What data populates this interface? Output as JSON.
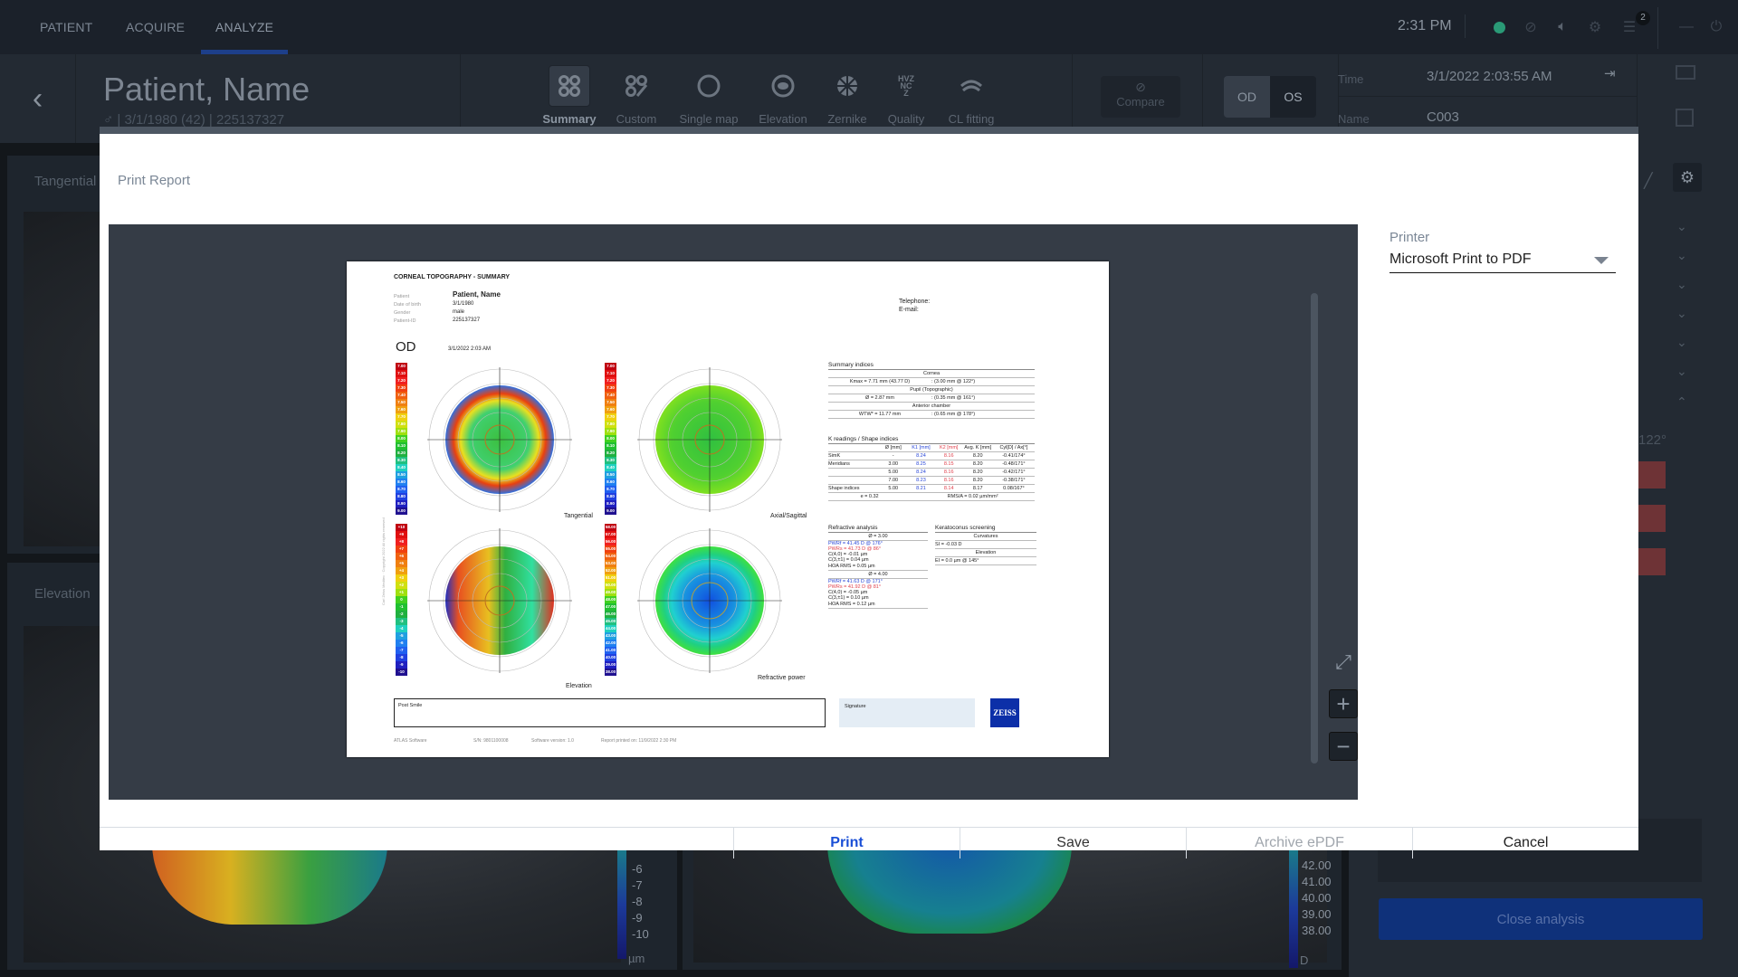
{
  "topbar": {
    "tabs": [
      {
        "label": "PATIENT",
        "active": false
      },
      {
        "label": "ACQUIRE",
        "active": false
      },
      {
        "label": "ANALYZE",
        "active": true
      }
    ],
    "clock": "2:31 PM",
    "status_color": "#2a9a76",
    "notification_count": "2",
    "icons": [
      "status-dot-icon",
      "visibility-off-icon",
      "volume-icon",
      "settings-icon",
      "task-list-icon",
      "minimize-icon",
      "power-icon"
    ]
  },
  "header": {
    "patient_name": "Patient, Name",
    "gender_symbol": "♂",
    "birth_info": "3/1/1980 (42)",
    "patient_id": "225137327",
    "view_tools": [
      {
        "label": "Summary",
        "icon": "summary-grid-icon",
        "active": true
      },
      {
        "label": "Custom",
        "icon": "custom-grid-icon",
        "active": false
      },
      {
        "label": "Single map",
        "icon": "single-map-icon",
        "active": false
      },
      {
        "label": "Elevation",
        "icon": "elevation-icon",
        "active": false
      },
      {
        "label": "Zernike",
        "icon": "zernike-icon",
        "active": false
      },
      {
        "label": "Quality",
        "icon": "quality-icon",
        "active": false
      },
      {
        "label": "CL fitting",
        "icon": "cl-fitting-icon",
        "active": false
      }
    ],
    "compare_label": "Compare",
    "eye_od": "OD",
    "eye_os": "OS",
    "selected_eye": "OD",
    "time_label": "Time",
    "time_value": "3/1/2022 2:03:55 AM",
    "name_label": "Name",
    "name_value": "C003"
  },
  "background": {
    "panel_tangential": "Tangential",
    "panel_elevation": "Elevation",
    "elevation_scale": [
      "-6",
      "-7",
      "-8",
      "-9",
      "-10"
    ],
    "elevation_unit": "µm",
    "power_scale": [
      "42.00",
      "41.00",
      "40.00",
      "39.00",
      "38.00"
    ],
    "power_unit": "D",
    "axis_angle_text": "122°",
    "close_analysis": "Close analysis"
  },
  "dialog": {
    "title": "Print Report",
    "printer_label": "Printer",
    "printer_value": "Microsoft Print to PDF",
    "buttons": {
      "print": "Print",
      "save": "Save",
      "archive": "Archive ePDF",
      "cancel": "Cancel"
    },
    "accent_color": "#1a4fd6"
  },
  "report": {
    "title": "CORNEAL TOPOGRAPHY - SUMMARY",
    "fields": [
      {
        "label": "Patient",
        "value": "Patient, Name"
      },
      {
        "label": "Date of birth",
        "value": "3/1/1980"
      },
      {
        "label": "Gender",
        "value": "male"
      },
      {
        "label": "Patient-ID",
        "value": "225137327"
      }
    ],
    "telephone": "Telephone:",
    "email": "E-mail:",
    "eye": "OD",
    "exam_date": "3/1/2022 2:03 AM",
    "maps": [
      {
        "label": "Tangential"
      },
      {
        "label": "Axial/Sagittal"
      },
      {
        "label": "Elevation"
      },
      {
        "label": "Refractive power"
      }
    ],
    "scale_radius": [
      "7.00",
      "7.10",
      "7.20",
      "7.30",
      "7.40",
      "7.50",
      "7.60",
      "7.70",
      "7.80",
      "7.90",
      "8.00",
      "8.10",
      "8.20",
      "8.30",
      "8.40",
      "8.50",
      "8.60",
      "8.70",
      "8.80",
      "8.90",
      "9.00"
    ],
    "scale_elevation": [
      "+10",
      "+9",
      "+8",
      "+7",
      "+6",
      "+5",
      "+4",
      "+3",
      "+2",
      "+1",
      "0",
      "-1",
      "-2",
      "-3",
      "-4",
      "-5",
      "-6",
      "-7",
      "-8",
      "-9",
      "-10"
    ],
    "scale_power": [
      "58.00",
      "57.00",
      "56.00",
      "55.00",
      "54.00",
      "53.00",
      "52.00",
      "51.00",
      "50.00",
      "49.00",
      "48.00",
      "47.00",
      "46.00",
      "45.00",
      "44.00",
      "43.00",
      "42.00",
      "41.00",
      "40.00",
      "39.00",
      "38.00"
    ],
    "summary": {
      "heading": "Summary indices",
      "cornea": "Cornea",
      "kmax": "Kmax = 7.71 mm (43.77 D)",
      "kmax_pos": ": (3.00 mm @ 122°)",
      "pupil": "Pupil (Topographic)",
      "pupil_d": "Ø = 2.87 mm",
      "pupil_pos": ": (0.35 mm @ 161°)",
      "anterior": "Anterior chamber",
      "wtw": "WTW* = 11.77 mm",
      "wtw_pos": ": (0.65 mm @ 178°)"
    },
    "kreadings": {
      "heading": "K readings / Shape indices",
      "columns": [
        "",
        "Ø [mm]",
        "K1 [mm]",
        "K2 [mm]",
        "Avg. K [mm]",
        "Cyl[D] / Ax[°]"
      ],
      "rows": [
        [
          "SimK",
          "-",
          "8.24",
          "8.16",
          "8.20",
          "-0.41/174°"
        ],
        [
          "Meridians",
          "3.00",
          "8.25",
          "8.15",
          "8.20",
          "-0.48/171°"
        ],
        [
          "",
          "5.00",
          "8.24",
          "8.16",
          "8.20",
          "-0.42/171°"
        ],
        [
          "",
          "7.00",
          "8.23",
          "8.16",
          "8.20",
          "-0.38/171°"
        ],
        [
          "Shape indices",
          "5.00",
          "8.21",
          "8.14",
          "8.17",
          "0.08/167°"
        ]
      ],
      "e": "e = 0.32",
      "rms": "RMS/A = 0.02 µm/mm²"
    },
    "refractive": {
      "heading": "Refractive analysis",
      "blocks": [
        {
          "d": "Ø = 3.00",
          "pwrf": "PWRf = 41.45 D @ 176°",
          "pwrs": "PWRs = 41.73 D @ 86°",
          "c40": "C(4,0) = -0.01 µm",
          "c31": "C(3,±1) = 0.04 µm",
          "hoa": "HOA RMS = 0.05 µm"
        },
        {
          "d": "Ø = 4.00",
          "pwrf": "PWRf = 41.63 D @ 171°",
          "pwrs": "PWRs = 41.92 D @ 81°",
          "c40": "C(4,0) = -0.05 µm",
          "c31": "C(3,±1) = 0.10 µm",
          "hoa": "HOA RMS = 0.12 µm"
        }
      ]
    },
    "keratoconus": {
      "heading": "Keratoconus screening",
      "curvatures": "Curvatures",
      "si": "SI  = -0.03 D",
      "elevation": "Elevation",
      "ei": "EI  = 0.0 µm @ 145°"
    },
    "post_label": "Post Smile",
    "signature_label": "Signature",
    "logo": "ZEISS",
    "footer": {
      "software": "ATLAS Software",
      "serial": "S/N: 9801100008",
      "version": "Software version: 1.0",
      "printed": "Report printed on: 11/9/2022 2:30 PM"
    },
    "copyright": "Carl Zeiss Meditec · Copyright 2022 All rights reserved"
  }
}
